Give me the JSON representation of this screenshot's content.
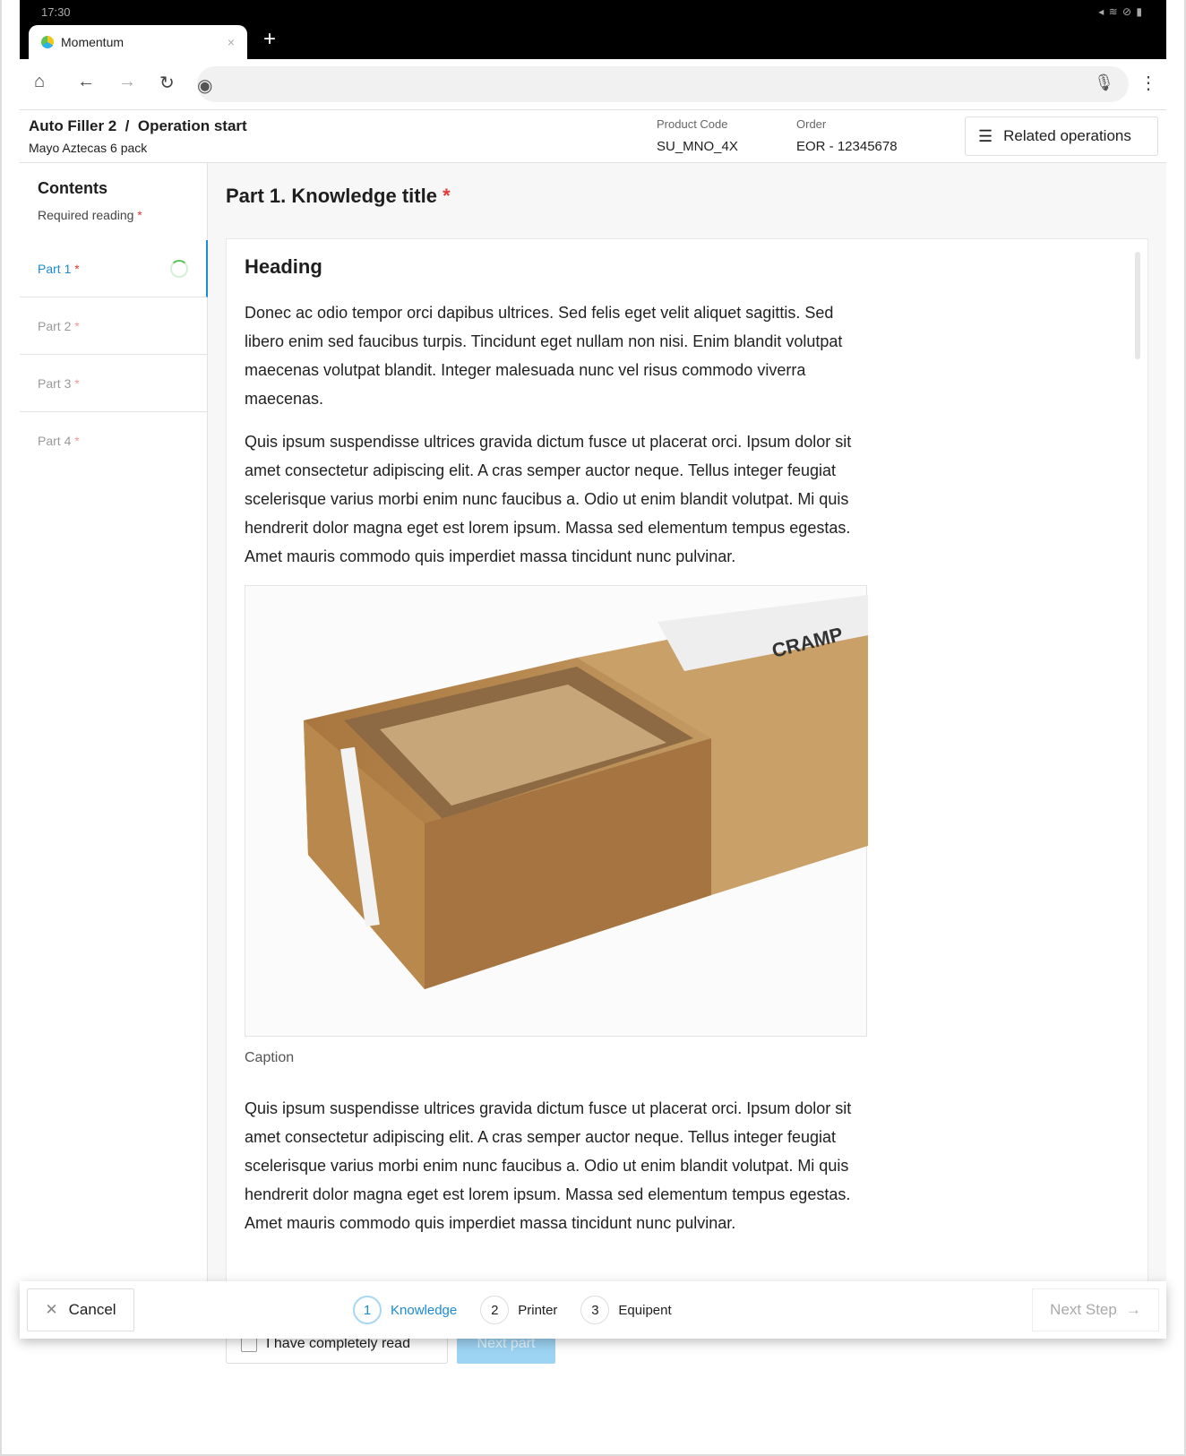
{
  "status_bar": {
    "time": "17:30",
    "icons": "◂ ≋ ⊘ ▮"
  },
  "browser": {
    "tab_title": "Momentum",
    "close": "×",
    "new_tab": "+"
  },
  "header": {
    "title": "Auto Filler 2  /  Operation start",
    "subtitle": "Mayo Aztecas 6 pack",
    "product_code_label": "Product Code",
    "product_code": "SU_MNO_4X",
    "order_label": "Order",
    "order": "EOR - 12345678",
    "related_label": "Related operations"
  },
  "sidebar": {
    "title": "Contents",
    "required": "Required reading",
    "items": [
      {
        "label": "Part 1"
      },
      {
        "label": "Part 2"
      },
      {
        "label": "Part 3"
      },
      {
        "label": "Part 4"
      }
    ]
  },
  "main": {
    "title": "Part 1. Knowledge title",
    "heading": "Heading",
    "p1": "Donec ac odio tempor orci dapibus ultrices. Sed felis eget velit aliquet sagittis. Sed libero enim sed faucibus turpis. Tincidunt eget nullam non nisi. Enim blandit volutpat maecenas volutpat blandit. Integer malesuada nunc vel risus commodo viverra maecenas.",
    "p2": "Quis ipsum suspendisse ultrices gravida dictum fusce ut placerat orci. Ipsum dolor sit amet consectetur adipiscing elit. A cras semper auctor neque. Tellus integer feugiat scelerisque varius morbi enim nunc faucibus a. Odio ut enim blandit volutpat. Mi quis hendrerit dolor magna eget est lorem ipsum. Massa sed elementum tempus egestas. Amet mauris commodo quis imperdiet massa tincidunt nunc pulvinar.",
    "image_label": "CRAMP",
    "caption": "Caption",
    "p3": "Quis ipsum suspendisse ultrices gravida dictum fusce ut placerat orci. Ipsum dolor sit amet consectetur adipiscing elit. A cras semper auctor neque. Tellus integer feugiat scelerisque varius morbi enim nunc faucibus a. Odio ut enim blandit volutpat. Mi quis hendrerit dolor magna eget est lorem ipsum. Massa sed elementum tempus egestas. Amet mauris commodo quis imperdiet massa tincidunt nunc pulvinar.",
    "read_label": "I have completely read",
    "next_part": "Next part"
  },
  "footer": {
    "cancel": "Cancel",
    "steps": [
      {
        "n": "1",
        "label": "Knowledge"
      },
      {
        "n": "2",
        "label": "Printer"
      },
      {
        "n": "3",
        "label": "Equipent"
      }
    ],
    "next_step": "Next Step"
  },
  "colors": {
    "accent": "#1b8bd6",
    "required": "#e53935",
    "next_part_bg": "#9dd3f3"
  }
}
